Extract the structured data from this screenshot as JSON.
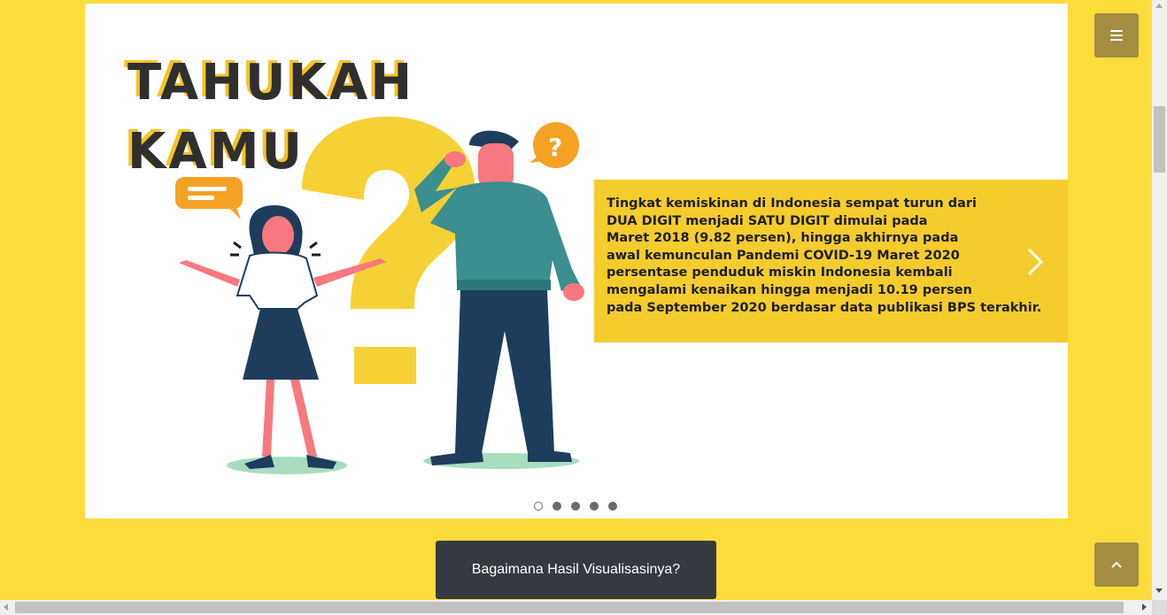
{
  "carousel": {
    "slide": {
      "title_line1": "TAHUKAH",
      "title_line2": "KAMU",
      "info_lines": [
        "Tingkat kemiskinan di Indonesia sempat turun dari",
        "DUA DIGIT menjadi SATU DIGIT dimulai pada",
        "Maret 2018 (9.82 persen), hingga akhirnya pada",
        "awal kemunculan Pandemi COVID-19 Maret 2020",
        "persentase penduduk miskin Indonesia kembali",
        "mengalami kenaikan hingga menjadi 10.19 persen",
        "pada September 2020 berdasar data publikasi BPS terakhir."
      ]
    },
    "indicator_count": 5,
    "active_indicator": 1,
    "next_icon": "chevron-right-icon"
  },
  "cta": {
    "label": "Bagaimana Hasil Visualisasinya?"
  },
  "menu_button": {
    "icon": "hamburger-icon"
  },
  "back_to_top": {
    "icon": "chevron-up-icon"
  },
  "colors": {
    "page_bg": "#fcdc3a",
    "accent_yellow": "#f4cc2e",
    "button_bg": "#a38d40",
    "cta_bg": "#343a40"
  }
}
